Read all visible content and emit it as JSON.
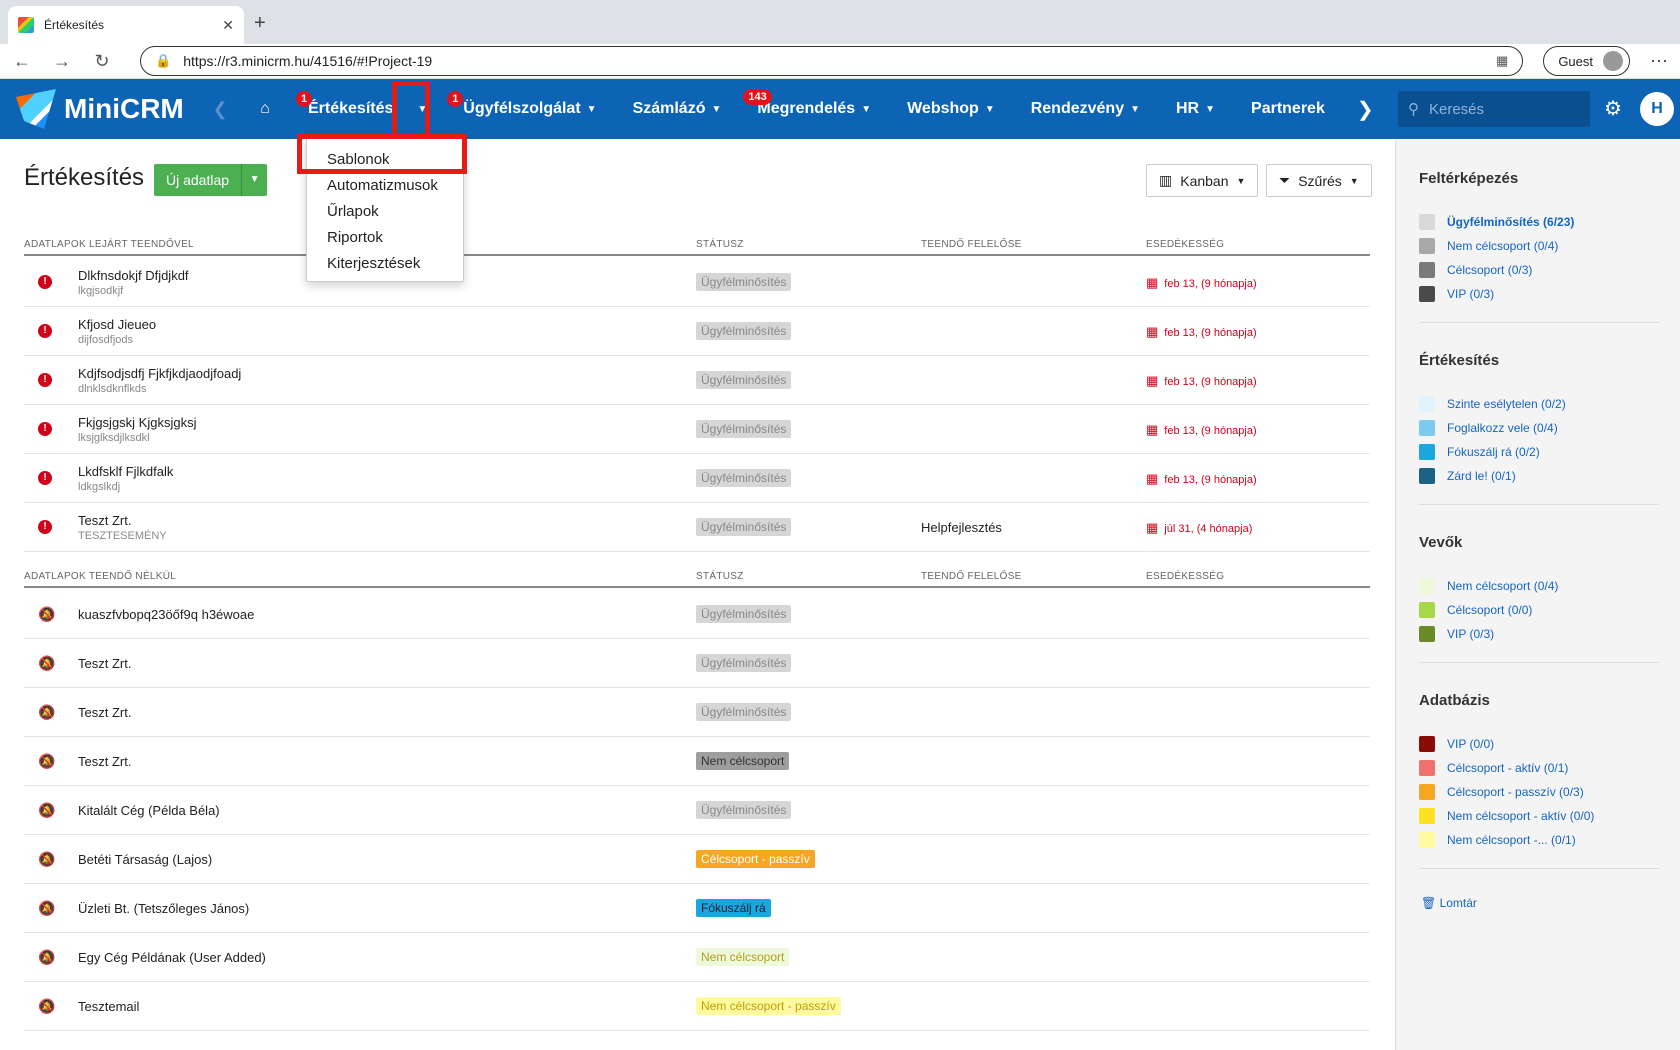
{
  "browser": {
    "tab_title": "Értékesítés",
    "url": "https://r3.minicrm.hu/41516/#!Project-19",
    "guest": "Guest"
  },
  "nav": {
    "logo": "MiniCRM",
    "items": [
      {
        "label": "Értékesítés",
        "badge": "1"
      },
      {
        "label": "Ügyfélszolgálat",
        "badge": "1"
      },
      {
        "label": "Számlázó",
        "badge": ""
      },
      {
        "label": "Megrendelés",
        "badge": "143"
      },
      {
        "label": "Webshop",
        "badge": ""
      },
      {
        "label": "Rendezvény",
        "badge": ""
      },
      {
        "label": "HR",
        "badge": ""
      },
      {
        "label": "Partnerek",
        "badge": ""
      }
    ],
    "search_placeholder": "Keresés",
    "avatar_letter": "H"
  },
  "dropdown": {
    "items": [
      "Sablonok",
      "Automatizmusok",
      "Űrlapok",
      "Riportok",
      "Kiterjesztések"
    ]
  },
  "page": {
    "title": "Értékesítés",
    "new_button": "Új adatlap",
    "kanban": "Kanban",
    "filter": "Szűrés"
  },
  "section1": {
    "header": "ADATLAPOK LEJÁRT TEENDŐVEL",
    "col_status": "STÁTUSZ",
    "col_resp": "TEENDŐ FELELŐSE",
    "col_due": "ESEDÉKESSÉG",
    "rows": [
      {
        "name": "Dlkfnsdokjf Dfjdjkdf",
        "sub": "lkgjsodkjf",
        "status": "Ügyfélminősítés",
        "resp": "",
        "due": "feb 13, (9 hónapja)"
      },
      {
        "name": "Kfjosd Jieueo",
        "sub": "dijfosdfjods",
        "status": "Ügyfélminősítés",
        "resp": "",
        "due": "feb 13, (9 hónapja)"
      },
      {
        "name": "Kdjfsodjsdfj Fjkfjkdjaodjfoadj",
        "sub": "dlnklsdknflkds",
        "status": "Ügyfélminősítés",
        "resp": "",
        "due": "feb 13, (9 hónapja)"
      },
      {
        "name": "Fkjgsjgskj Kjgksjgksj",
        "sub": "lksjglksdjlksdkl",
        "status": "Ügyfélminősítés",
        "resp": "",
        "due": "feb 13, (9 hónapja)"
      },
      {
        "name": "Lkdfsklf Fjlkdfalk",
        "sub": "ldkgslkdj",
        "status": "Ügyfélminősítés",
        "resp": "",
        "due": "feb 13, (9 hónapja)"
      },
      {
        "name": "Teszt Zrt.",
        "sub": "TESZTESEMÉNY",
        "status": "Ügyfélminősítés",
        "resp": "Helpfejlesztés",
        "due": "júl 31, (4 hónapja)"
      }
    ]
  },
  "section2": {
    "header": "ADATLAPOK TEENDŐ NÉLKÜL",
    "col_status": "STÁTUSZ",
    "col_resp": "TEENDŐ FELELŐSE",
    "col_due": "ESEDÉKESSÉG",
    "rows": [
      {
        "name": "kuaszfvbopq23öőf9q h3éwoae",
        "status": "Ügyfélminősítés",
        "bg": "#d6d6d6",
        "fg": "#888"
      },
      {
        "name": "Teszt Zrt.",
        "status": "Ügyfélminősítés",
        "bg": "#d6d6d6",
        "fg": "#888"
      },
      {
        "name": "Teszt Zrt.",
        "status": "Ügyfélminősítés",
        "bg": "#d6d6d6",
        "fg": "#888"
      },
      {
        "name": "Teszt Zrt.",
        "status": "Nem célcsoport",
        "bg": "#9e9e9e",
        "fg": "#333"
      },
      {
        "name": "Kitalált Cég (Példa Béla)",
        "status": "Ügyfélminősítés",
        "bg": "#d6d6d6",
        "fg": "#888"
      },
      {
        "name": "Betéti Társaság (Lajos)",
        "status": "Célcsoport - passzív",
        "bg": "#f5a623",
        "fg": "#fff"
      },
      {
        "name": "Üzleti Bt. (Tetszőleges János)",
        "status": "Fókuszálj rá",
        "bg": "#1aa7e0",
        "fg": "#123"
      },
      {
        "name": "Egy Cég Példának (User Added)",
        "status": "Nem célcsoport",
        "bg": "#eef8da",
        "fg": "#b0a020"
      },
      {
        "name": "Tesztemail",
        "status": "Nem célcsoport - passzív",
        "bg": "#fffaa0",
        "fg": "#c0a000"
      }
    ]
  },
  "sidebar": {
    "groups": [
      {
        "title": "Feltérképezés",
        "items": [
          {
            "label": "Ügyfélminősítés (6/23)",
            "color": "#d9d9d9",
            "bold": true
          },
          {
            "label": "Nem célcsoport (0/4)",
            "color": "#a8a8a8"
          },
          {
            "label": "Célcsoport (0/3)",
            "color": "#7a7a7a"
          },
          {
            "label": "VIP (0/3)",
            "color": "#4a4a4a"
          }
        ]
      },
      {
        "title": "Értékesítés",
        "items": [
          {
            "label": "Szinte esélytelen (0/2)",
            "color": "#e2f2fb"
          },
          {
            "label": "Foglalkozz vele (0/4)",
            "color": "#7ccbef"
          },
          {
            "label": "Fókuszálj rá (0/2)",
            "color": "#1aa7e0"
          },
          {
            "label": "Zárd le! (0/1)",
            "color": "#1b6286"
          }
        ]
      },
      {
        "title": "Vevők",
        "items": [
          {
            "label": "Nem célcsoport (0/4)",
            "color": "#eef8da"
          },
          {
            "label": "Célcsoport (0/0)",
            "color": "#a8d84a"
          },
          {
            "label": "VIP (0/3)",
            "color": "#6a8a2a"
          }
        ]
      },
      {
        "title": "Adatbázis",
        "items": [
          {
            "label": "VIP (0/0)",
            "color": "#8b0a0a"
          },
          {
            "label": "Célcsoport - aktív (0/1)",
            "color": "#f07070"
          },
          {
            "label": "Célcsoport - passzív (0/3)",
            "color": "#f5a623"
          },
          {
            "label": "Nem célcsoport - aktív (0/0)",
            "color": "#ffe020"
          },
          {
            "label": "Nem célcsoport -... (0/1)",
            "color": "#fffaa0"
          }
        ]
      }
    ],
    "trash": "Lomtár"
  }
}
